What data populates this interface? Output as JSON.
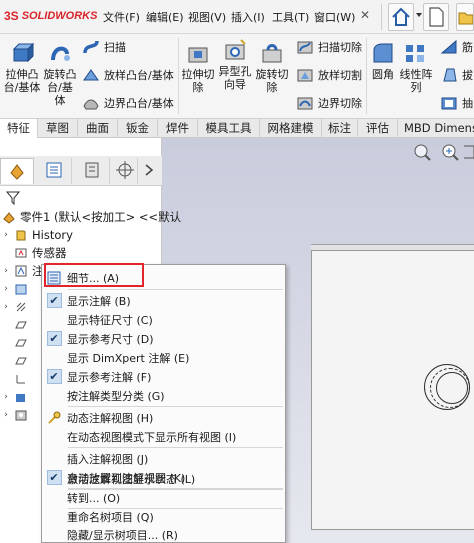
{
  "app": {
    "logo_ds": "3S",
    "logo_name": "SOLIDWORKS",
    "accent": "#d9242a"
  },
  "menu": [
    "文件(F)",
    "编辑(E)",
    "视图(V)",
    "插入(I)",
    "工具(T)",
    "窗口(W)"
  ],
  "ribbon": {
    "extrude_boss": "拉伸凸台/基体",
    "revolve_boss": "旋转凸台/基体",
    "sweep": "扫描",
    "loft_boss": "放样凸台/基体",
    "boundary_boss": "边界凸台/基体",
    "extrude_cut": "拉伸切除",
    "hole_wizard": "异型孔向导",
    "revolve_cut": "旋转切除",
    "sweep_cut": "扫描切除",
    "loft_cut": "放样切割",
    "boundary_cut": "边界切除",
    "fillet": "圆角",
    "linear_pattern": "线性阵列",
    "rib": "筋",
    "draft": "拔",
    "shell": "抽"
  },
  "tabs": [
    "特征",
    "草图",
    "曲面",
    "钣金",
    "焊件",
    "模具工具",
    "网格建模",
    "标注",
    "评估",
    "MBD Dimensi"
  ],
  "tree": {
    "part": "零件1 (默认<按加工> <<默认",
    "history": "History",
    "sensors": "传感器",
    "annotations": "注解"
  },
  "context_menu": [
    {
      "label": "细节... (A)",
      "icon": "details-icon",
      "checked": false
    },
    {
      "label": "显示注解 (B)",
      "checked": true
    },
    {
      "label": "显示特征尺寸 (C)",
      "checked": false
    },
    {
      "label": "显示参考尺寸 (D)",
      "checked": true
    },
    {
      "label": "显示 DimXpert 注解 (E)",
      "checked": false
    },
    {
      "label": "显示参考注解 (F)",
      "checked": true
    },
    {
      "label": "按注解类型分类 (G)",
      "checked": false
    },
    {
      "label": "动态注解视图 (H)",
      "icon": "dynamic-annotation-icon",
      "checked": false
    },
    {
      "label": "在动态视图模式下显示所有视图 (I)",
      "checked": false
    },
    {
      "label": "插入注解视图 (J)",
      "checked": false
    },
    {
      "label": "自动放置到注解视图 (K)",
      "checked": true
    },
    {
      "label": "激活注解视图显示状态 (L)",
      "checked": false
    },
    {
      "label": "转到... (O)",
      "checked": false
    },
    {
      "label": "重命名树项目 (Q)",
      "checked": false
    },
    {
      "label": "隐藏/显示树项目... (R)",
      "checked": false
    }
  ],
  "colors": {
    "highlight_box": "#e0262b",
    "check_bg": "#cfe0f3"
  }
}
